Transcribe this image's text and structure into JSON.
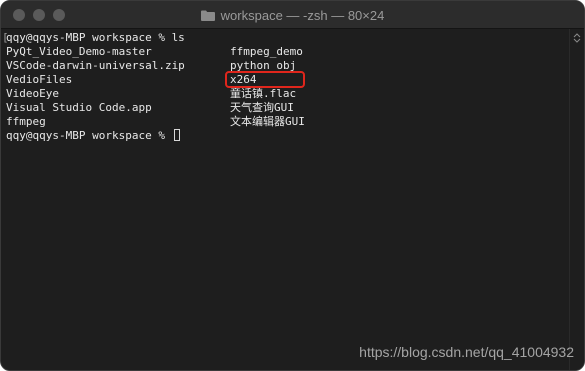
{
  "window": {
    "title": "workspace — -zsh — 80×24",
    "folder_icon": "folder-icon"
  },
  "terminal": {
    "prompt_line_1": "qqy@qqys-MBP workspace % ls",
    "prompt_line_2": "qqy@qqys-MBP workspace % ",
    "bracket": "[",
    "col1": [
      "PyQt_Video_Demo-master",
      "VSCode-darwin-universal.zip",
      "VedioFiles",
      "VideoEye",
      "Visual Studio Code.app",
      "ffmpeg"
    ],
    "col2": [
      "ffmpeg_demo",
      "python_obj",
      "x264",
      "童话镇.flac",
      "天气查询GUI",
      "文本编辑器GUI"
    ]
  },
  "watermark": "https://blog.csdn.net/qq_41004932",
  "colors": {
    "background": "#1e1e1e",
    "text": "#e8e8e8",
    "highlight": "#e0261c"
  }
}
